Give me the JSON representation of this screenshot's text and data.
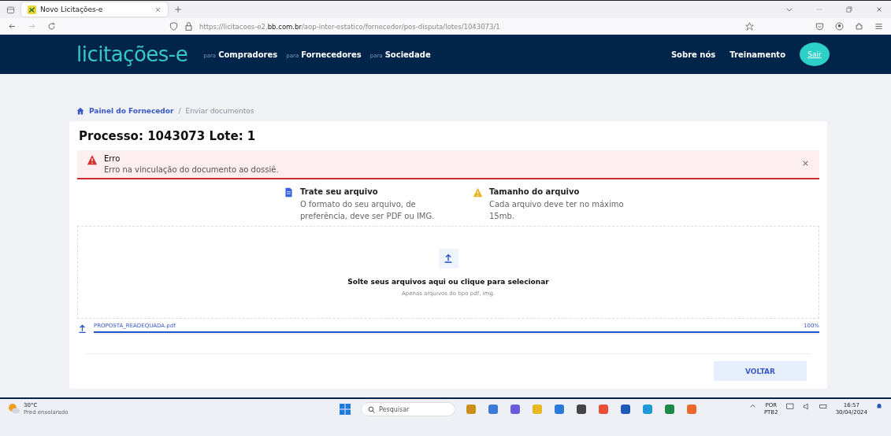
{
  "browser": {
    "tabs": [
      {
        "title": "Novo Licitações-e",
        "selected": true
      }
    ],
    "url_host": "https://licitacoes-e2.",
    "url_domain": "bb.com.br",
    "url_path": "/aop-inter-estatico/fornecedor/pos-disputa/lotes/1043073/1"
  },
  "header": {
    "logo": "licitações-e",
    "nav": [
      {
        "prefix": "para",
        "label": "Compradores"
      },
      {
        "prefix": "para",
        "label": "Fornecedores"
      },
      {
        "prefix": "para",
        "label": "Sociedade"
      }
    ],
    "links": [
      "Sobre nós",
      "Treinamento"
    ],
    "logout": "Sair"
  },
  "breadcrumb_separator": "/",
  "breadcrumb": [
    {
      "label": "Painel do Fornecedor",
      "selected": false
    },
    {
      "label": "Enviar documentos",
      "selected": true
    }
  ],
  "title": "Processo: 1043073 Lote: 1",
  "alert": {
    "title": "Erro",
    "message": "Erro na vinculação do documento ao dossiê."
  },
  "tips": [
    {
      "kind": "file",
      "title": "Trate seu arquivo",
      "text": "O formato do seu arquivo, de preferência, deve ser PDF ou IMG."
    },
    {
      "kind": "warning",
      "title": "Tamanho do arquivo",
      "text": "Cada arquivo deve ter no máximo 15mb."
    }
  ],
  "dropzone": {
    "title": "Solte seus arquivos aqui ou clique para selecionar",
    "hint": "Apenas arquivos do tipo pdf, img."
  },
  "files": [
    {
      "name": "PROPOSTA_READEQUADA.pdf",
      "level": 1,
      "reading": "100%"
    }
  ],
  "back_button": "VOLTAR",
  "taskbar": {
    "weather_temp": "30°C",
    "weather_text": "Pred ensolarado",
    "search": "Pesquisar",
    "lang": "POR",
    "layout": "PTB2",
    "time": "16:57",
    "date": "30/04/2024"
  }
}
